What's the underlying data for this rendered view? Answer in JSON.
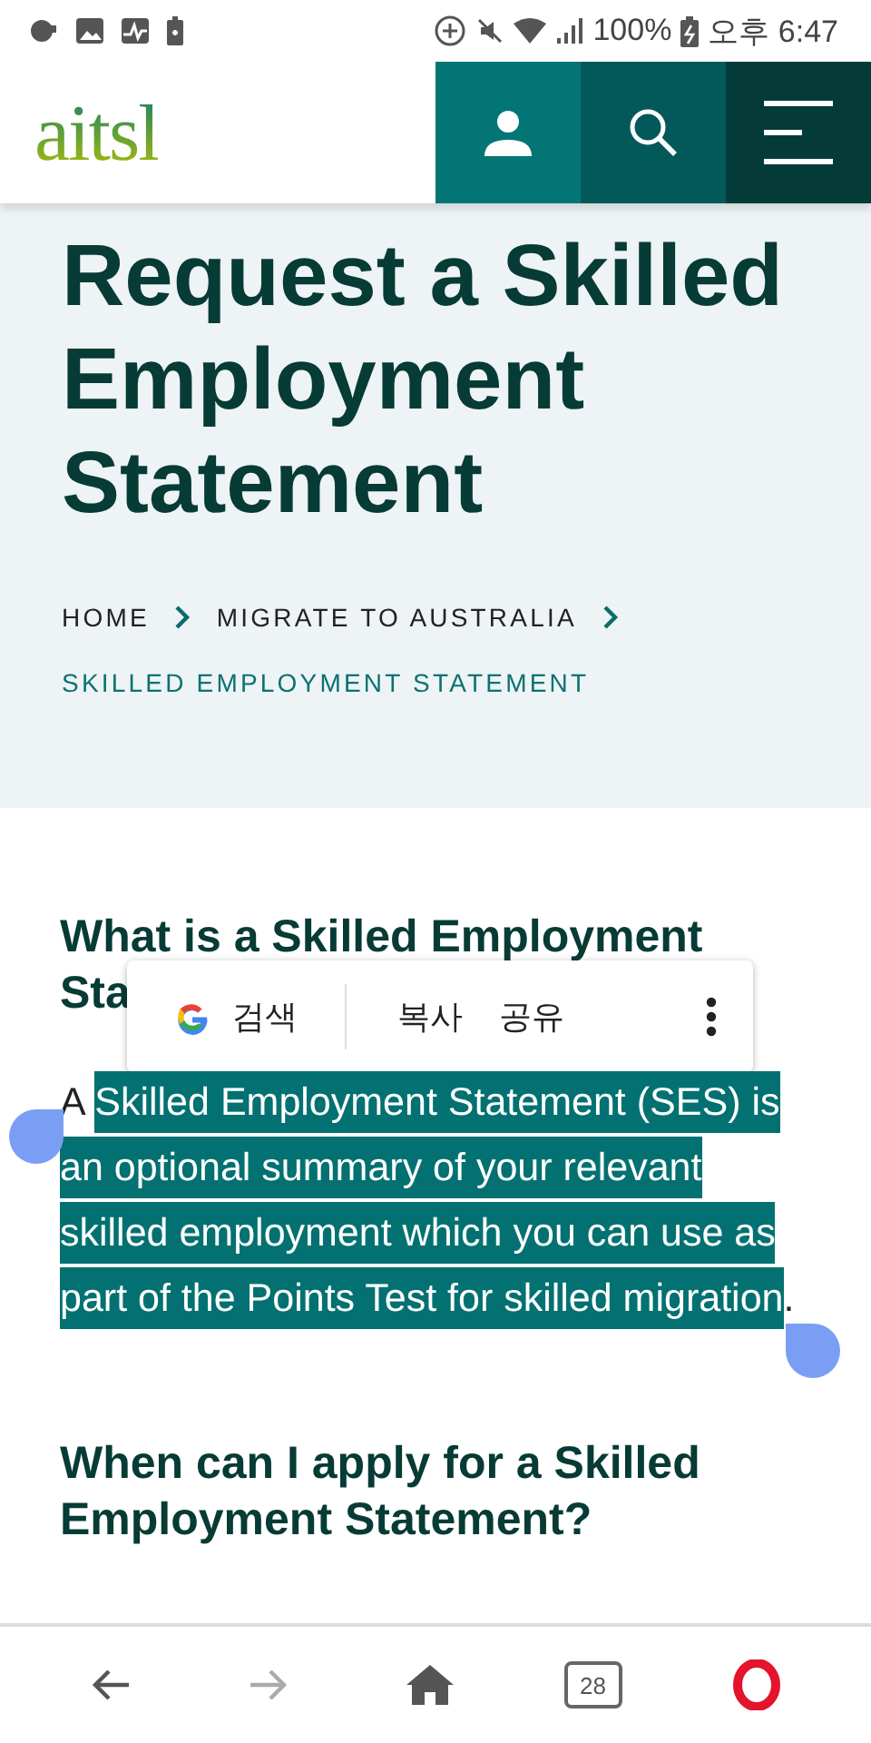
{
  "status_bar": {
    "battery": "100%",
    "time": "오후 6:47"
  },
  "header": {
    "logo": "aitsl"
  },
  "page_title": "Request a Skilled Employment Statement",
  "breadcrumb": [
    {
      "label": "HOME",
      "current": false
    },
    {
      "label": "MIGRATE TO AUSTRALIA",
      "current": false
    },
    {
      "label": "SKILLED EMPLOYMENT STATEMENT",
      "current": true
    }
  ],
  "section": {
    "heading_lines": [
      "What is a Skilled Employment",
      "Sta"
    ],
    "paragraph": {
      "before": "A ",
      "selected": "Skilled Employment Statement (SES) is an optional summary of your relevant skilled employment which you can use as part of the Points Test for skilled migration",
      "after": "."
    }
  },
  "context_menu": {
    "items": [
      {
        "kind": "search",
        "label": "검색"
      },
      {
        "kind": "action",
        "label": "복사"
      },
      {
        "kind": "action",
        "label": "공유"
      }
    ]
  },
  "next_heading": "When can I apply for a Skilled Employment Statement?",
  "bottom_nav": {
    "forward_disabled": true,
    "tabs_count": "28"
  }
}
